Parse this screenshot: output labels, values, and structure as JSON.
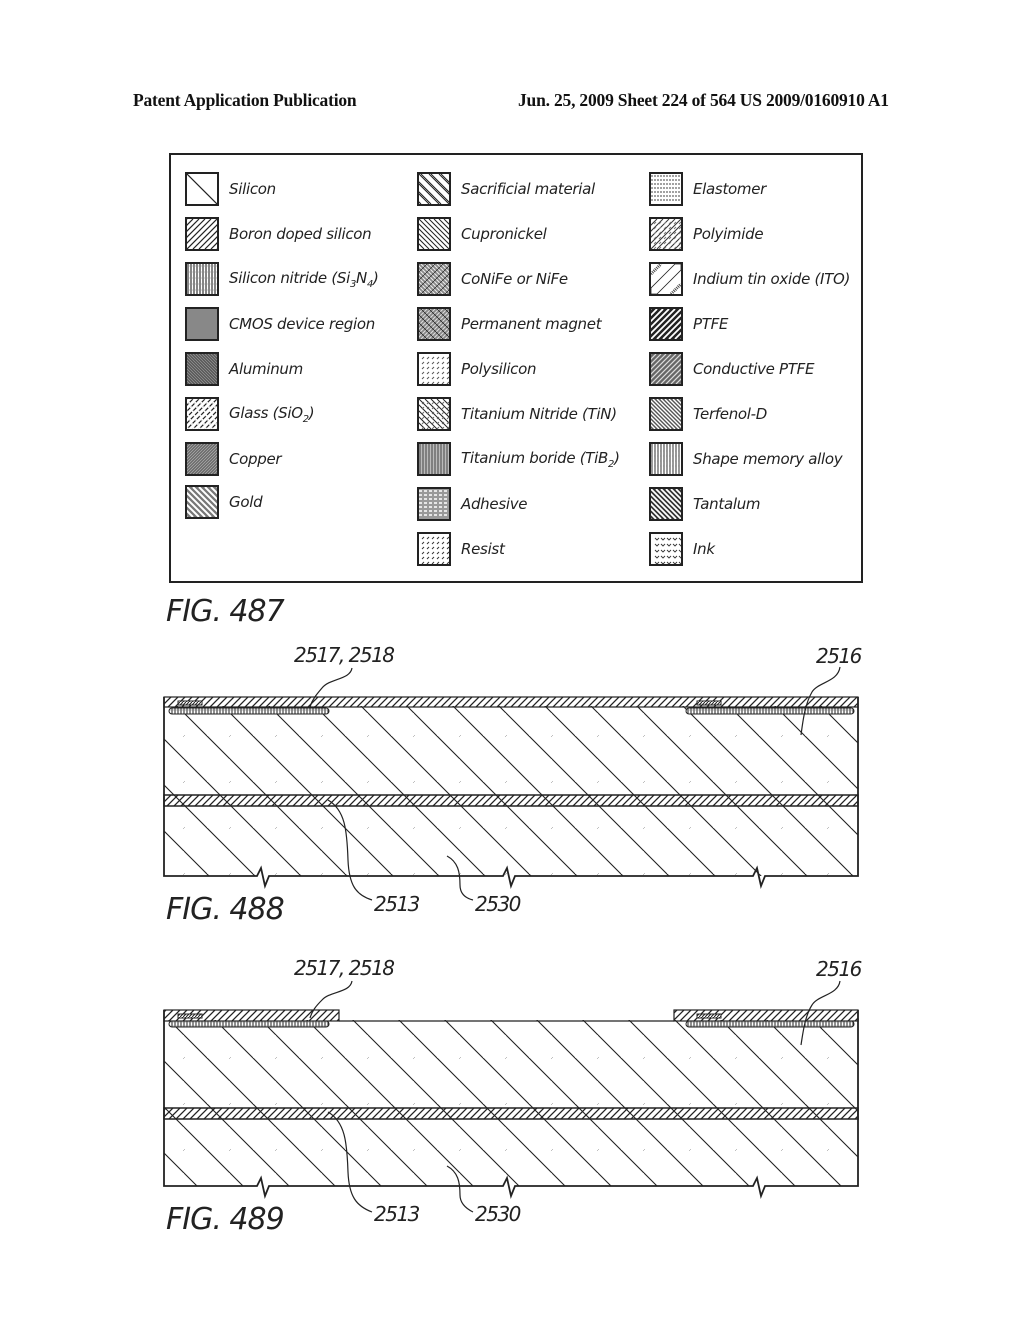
{
  "header": {
    "left": "Patent Application Publication",
    "right": "Jun. 25, 2009  Sheet 224 of 564   US 2009/0160910 A1"
  },
  "legend": {
    "columns": [
      [
        {
          "label": "Silicon",
          "pattern": "silicon"
        },
        {
          "label": "Boron doped silicon",
          "pattern": "boron"
        },
        {
          "label": "Silicon nitride (Si",
          "sub1": "3",
          "mid": "N",
          "sub2": "4",
          "tail": ")",
          "pattern": "nitride"
        },
        {
          "label": "CMOS device region",
          "pattern": "cmos"
        },
        {
          "label": "Aluminum",
          "pattern": "aluminum"
        },
        {
          "label": "Glass (SiO",
          "sub1": "2",
          "tail": ")",
          "pattern": "glass"
        },
        {
          "label": "Copper",
          "pattern": "copper"
        },
        {
          "label": "Gold",
          "pattern": "gold"
        }
      ],
      [
        {
          "label": "Sacrificial material",
          "pattern": "sacrificial"
        },
        {
          "label": "Cupronickel",
          "pattern": "cupronickel"
        },
        {
          "label": "CoNiFe or NiFe",
          "pattern": "conife"
        },
        {
          "label": "Permanent magnet",
          "pattern": "magnet"
        },
        {
          "label": "Polysilicon",
          "pattern": "polysilicon"
        },
        {
          "label": "Titanium Nitride (TiN)",
          "pattern": "tin"
        },
        {
          "label": "Titanium boride (TiB",
          "sub1": "2",
          "tail": ")",
          "pattern": "tib2"
        },
        {
          "label": "Adhesive",
          "pattern": "adhesive"
        },
        {
          "label": "Resist",
          "pattern": "resist"
        }
      ],
      [
        {
          "label": "Elastomer",
          "pattern": "elastomer"
        },
        {
          "label": "Polyimide",
          "pattern": "polyimide"
        },
        {
          "label": "Indium tin oxide (ITO)",
          "pattern": "ito"
        },
        {
          "label": "PTFE",
          "pattern": "ptfe"
        },
        {
          "label": "Conductive PTFE",
          "pattern": "cptfe"
        },
        {
          "label": "Terfenol-D",
          "pattern": "terfenol"
        },
        {
          "label": "Shape memory alloy",
          "pattern": "sma"
        },
        {
          "label": "Tantalum",
          "pattern": "tantalum"
        },
        {
          "label": "Ink",
          "pattern": "ink"
        }
      ]
    ]
  },
  "figures": [
    {
      "id": "fig487",
      "label": "FIG. 487"
    },
    {
      "id": "fig488",
      "label": "FIG. 488",
      "refs": {
        "top_left": "2517, 2518",
        "top_right": "2516",
        "bottom_a": "2513",
        "bottom_b": "2530"
      }
    },
    {
      "id": "fig489",
      "label": "FIG. 489",
      "refs": {
        "top_left": "2517, 2518",
        "top_right": "2516",
        "bottom_a": "2513",
        "bottom_b": "2530"
      }
    }
  ]
}
